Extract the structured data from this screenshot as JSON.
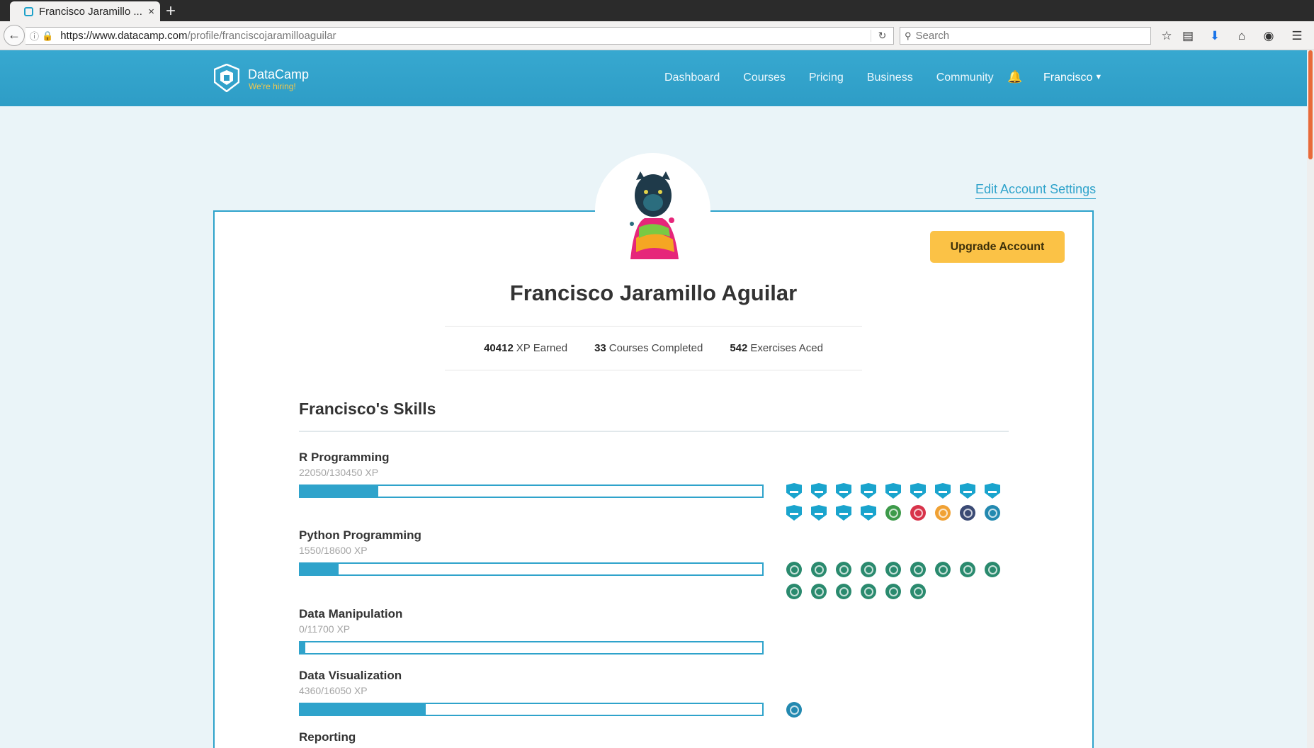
{
  "browser": {
    "tab_title": "Francisco Jaramillo ...",
    "tab_close": "×",
    "new_tab": "+",
    "url_domain": "https://www.datacamp.com",
    "url_path": "/profile/franciscojaramilloaguilar",
    "search_placeholder": "Search"
  },
  "header": {
    "brand": "DataCamp",
    "hiring": "We're hiring!",
    "nav": [
      "Dashboard",
      "Courses",
      "Pricing",
      "Business",
      "Community"
    ],
    "user": "Francisco"
  },
  "profile": {
    "edit_settings": "Edit Account Settings",
    "upgrade": "Upgrade Account",
    "name": "Francisco Jaramillo Aguilar",
    "stats": [
      {
        "value": "40412",
        "label": "XP Earned"
      },
      {
        "value": "33",
        "label": "Courses Completed"
      },
      {
        "value": "542",
        "label": "Exercises Aced"
      }
    ]
  },
  "skills": {
    "title": "Francisco's Skills",
    "items": [
      {
        "name": "R Programming",
        "xp": "22050/130450 XP",
        "progress": 0.169,
        "badges": [
          "shield",
          "shield",
          "shield",
          "shield",
          "shield",
          "shield",
          "shield",
          "shield",
          "shield",
          "shield",
          "shield",
          "shield",
          "shield",
          "#3d9a4a",
          "#d8334a",
          "#f0a134",
          "#3a4a74",
          "#2389b0"
        ]
      },
      {
        "name": "Python Programming",
        "xp": "1550/18600 XP",
        "progress": 0.083,
        "badges": [
          "#2a8a6e",
          "#2a8a6e",
          "#2a8a6e",
          "#2a8a6e",
          "#2a8a6e",
          "#2a8a6e",
          "#2a8a6e",
          "#2a8a6e",
          "#2a8a6e",
          "#2a8a6e",
          "#2a8a6e",
          "#2a8a6e",
          "#2a8a6e",
          "#2a8a6e",
          "#2a8a6e"
        ]
      },
      {
        "name": "Data Manipulation",
        "xp": "0/11700 XP",
        "progress": 0,
        "badges": []
      },
      {
        "name": "Data Visualization",
        "xp": "4360/16050 XP",
        "progress": 0.272,
        "badges": [
          "#2389b0"
        ]
      },
      {
        "name": "Reporting",
        "xp": "",
        "progress": 0,
        "badges": []
      }
    ]
  },
  "colors": {
    "accent": "#2fa3cb",
    "upgrade": "#fbc246",
    "hiring": "#f5c84a"
  }
}
